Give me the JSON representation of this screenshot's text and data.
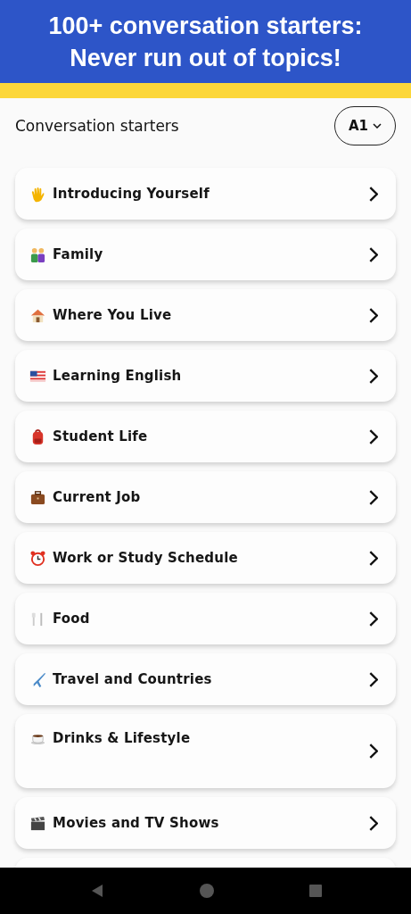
{
  "banner": {
    "title": "100+ conversation starters: Never run out of topics!"
  },
  "header": {
    "title": "Conversation starters",
    "level_selector": "A1"
  },
  "topics": [
    {
      "label": "Introducing Yourself",
      "kind": "single"
    },
    {
      "label": "Family",
      "kind": "single"
    },
    {
      "label": "Where You Live",
      "kind": "single"
    },
    {
      "label": "Learning English",
      "kind": "single"
    },
    {
      "label": "Student Life",
      "kind": "single"
    },
    {
      "label": "Current Job",
      "kind": "single"
    },
    {
      "label": "Work or Study Schedule",
      "kind": "single"
    },
    {
      "label": "Food",
      "kind": "single"
    },
    {
      "label": "Travel and Countries",
      "kind": "single"
    },
    {
      "label": "Drinks & Lifestyle",
      "kind": "tall"
    },
    {
      "label": "Movies and TV Shows",
      "kind": "single"
    }
  ]
}
